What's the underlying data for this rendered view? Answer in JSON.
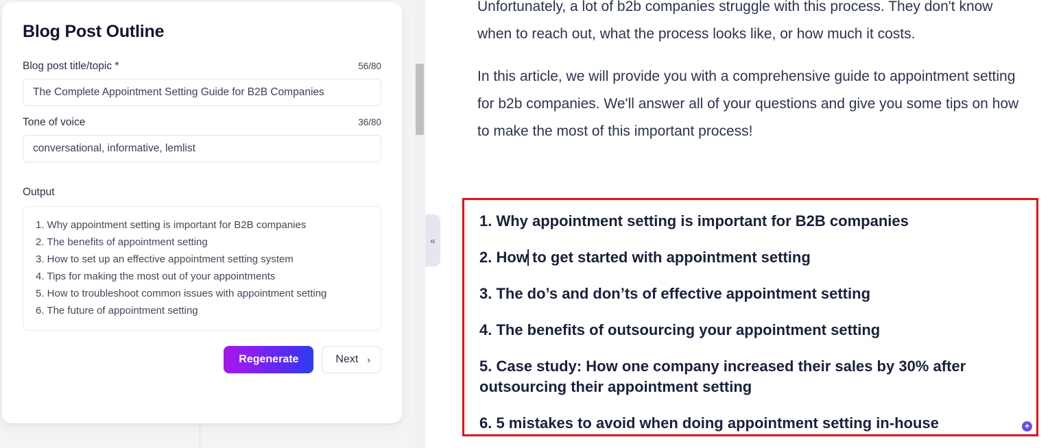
{
  "form_card": {
    "title": "Blog Post Outline",
    "fields": [
      {
        "label": "Blog post title/topic *",
        "counter": "56/80",
        "value": "The Complete Appointment Setting Guide for B2B Companies",
        "placeholder": "Blog post title/topic"
      },
      {
        "label": "Tone of voice",
        "counter": "36/80",
        "value": "conversational, informative, lemlist",
        "placeholder": "Tone of voice"
      }
    ],
    "output_label": "Output",
    "output_items": [
      "1. Why appointment setting is important for B2B companies",
      "2. The benefits of appointment setting",
      "3. How to set up an effective appointment setting system",
      "4. Tips for making the most out of your appointments",
      "5. How to troubleshoot common issues with appointment setting",
      "6. The future of appointment setting"
    ],
    "regenerate_label": "Regenerate",
    "next_label": "Next",
    "next_chevron": "›"
  },
  "collapse_handle": {
    "icon": "double-chevron-left",
    "glyph": "«"
  },
  "article": {
    "paragraphs": [
      "Unfortunately, a lot of b2b companies struggle with this process. They don't know when to reach out, what the process looks like, or how much it costs.",
      "In this article, we will provide you with a comprehensive guide to appointment setting for b2b companies. We'll answer all of your questions and give you some tips on how to make the most of this important process!"
    ]
  },
  "outline_block": {
    "highlight_color": "#e01119",
    "items": [
      {
        "before": "1. Why appointment setting is important for B2B companies",
        "caret": false,
        "after": ""
      },
      {
        "before": "2. How",
        "caret": true,
        "after": " to get started with appointment setting"
      },
      {
        "before": "3. The do’s and don’ts of effective appointment setting",
        "caret": false,
        "after": ""
      },
      {
        "before": "4. The benefits of outsourcing your appointment setting",
        "caret": false,
        "after": ""
      },
      {
        "before": "5. Case study: How one company increased their sales by 30% after outsourcing their appointment setting",
        "caret": false,
        "after": ""
      },
      {
        "before": "6. 5 mistakes to avoid when doing appointment setting in-house",
        "caret": false,
        "after": ""
      }
    ],
    "plus_badge": "+"
  }
}
